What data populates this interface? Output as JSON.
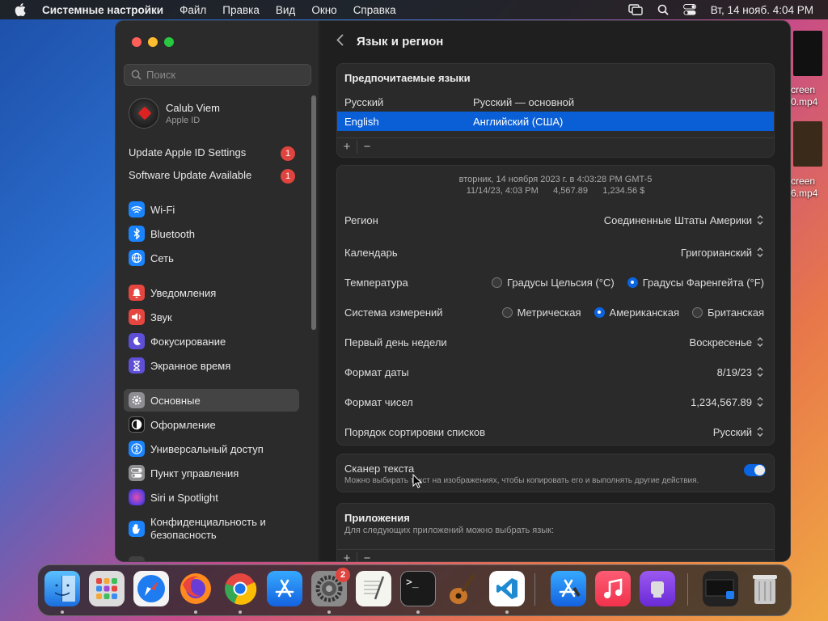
{
  "menubar": {
    "app": "Системные настройки",
    "items": [
      "Файл",
      "Правка",
      "Вид",
      "Окно",
      "Справка"
    ],
    "clock": "Вт, 14 нояб.  4:04 PM"
  },
  "desktop": {
    "file1": "creen\n0.mp4",
    "file2": "creen\n6.mp4"
  },
  "sidebar": {
    "search_placeholder": "Поиск",
    "profile_name": "Calub Viem",
    "profile_sub": "Apple ID",
    "notifications": [
      {
        "label": "Update Apple ID Settings",
        "badge": "1"
      },
      {
        "label": "Software Update Available",
        "badge": "1"
      }
    ],
    "items": [
      {
        "label": "Wi-Fi",
        "color": "#1a84ff"
      },
      {
        "label": "Bluetooth",
        "color": "#1a84ff"
      },
      {
        "label": "Сеть",
        "color": "#1a84ff"
      },
      {
        "label": "Уведомления",
        "color": "#e5463f"
      },
      {
        "label": "Звук",
        "color": "#e5463f"
      },
      {
        "label": "Фокусирование",
        "color": "#5e4fd6"
      },
      {
        "label": "Экранное время",
        "color": "#5e4fd6"
      },
      {
        "label": "Основные",
        "color": "#8e8e93"
      },
      {
        "label": "Оформление",
        "color": "#111111"
      },
      {
        "label": "Универсальный доступ",
        "color": "#1a84ff"
      },
      {
        "label": "Пункт управления",
        "color": "#8e8e93"
      },
      {
        "label": "Siri и Spotlight",
        "color": "#a24ad6"
      },
      {
        "label": "Конфиденциальность и безопасность",
        "color": "#1a84ff"
      }
    ]
  },
  "main": {
    "title": "Язык и регион",
    "languages": {
      "title": "Предпочитаемые языки",
      "rows": [
        {
          "name": "Русский",
          "desc": "Русский — основной"
        },
        {
          "name": "English",
          "desc": "Английский (США)"
        }
      ],
      "add": "+",
      "remove": "−"
    },
    "preview": {
      "line1": "вторник, 14 ноября 2023 г. в 4:03:28 PM GMT-5",
      "line2": "11/14/23, 4:03 PM      4,567.89      1,234.56 $"
    },
    "settings": {
      "region_label": "Регион",
      "region_value": "Соединенные Штаты Америки",
      "calendar_label": "Календарь",
      "calendar_value": "Григорианский",
      "temp_label": "Температура",
      "temp_c": "Градусы Цельсия (°C)",
      "temp_f": "Градусы Фаренгейта (°F)",
      "measure_label": "Система измерений",
      "measure_metric": "Метрическая",
      "measure_us": "Американская",
      "measure_uk": "Британская",
      "week_label": "Первый день недели",
      "week_value": "Воскресенье",
      "date_label": "Формат даты",
      "date_value": "8/19/23",
      "number_label": "Формат чисел",
      "number_value": "1,234,567.89",
      "sort_label": "Порядок сортировки списков",
      "sort_value": "Русский"
    },
    "scanner": {
      "title": "Сканер текста",
      "desc": "Можно выбирать текст на изображениях, чтобы копировать его и выполнять другие действия."
    },
    "apps": {
      "title": "Приложения",
      "desc": "Для следующих приложений можно выбрать язык:"
    }
  },
  "dock": {
    "settings_badge": "2",
    "terminal_prompt": ">_"
  }
}
